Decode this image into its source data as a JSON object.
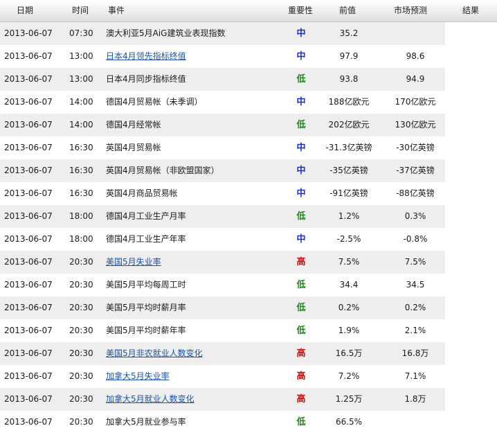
{
  "headers": {
    "date": "日期",
    "time": "时间",
    "event": "事件",
    "importance": "重要性",
    "previous": "前值",
    "forecast": "市场预测",
    "result": "结果"
  },
  "colors": {
    "high": "#cc1111",
    "medium": "#1a2cc8",
    "low": "#1a8a1a",
    "link": "#1a53a7",
    "row_alt": "#eeeeee"
  },
  "rows": [
    {
      "date": "2013-06-07",
      "time": "07:30",
      "event": "澳大利亚5月AiG建筑业表现指数",
      "link": false,
      "importance": "中",
      "level": "mid",
      "previous": "35.2",
      "forecast": "",
      "result": ""
    },
    {
      "date": "2013-06-07",
      "time": "13:00",
      "event": "日本4月领先指标终值",
      "link": true,
      "importance": "中",
      "level": "mid",
      "previous": "97.9",
      "forecast": "98.6",
      "result": ""
    },
    {
      "date": "2013-06-07",
      "time": "13:00",
      "event": "日本4月同步指标终值",
      "link": false,
      "importance": "低",
      "level": "low",
      "previous": "93.8",
      "forecast": "94.9",
      "result": ""
    },
    {
      "date": "2013-06-07",
      "time": "14:00",
      "event": "德国4月贸易帐（未季调）",
      "link": false,
      "importance": "中",
      "level": "mid",
      "previous": "188亿欧元",
      "forecast": "170亿欧元",
      "result": ""
    },
    {
      "date": "2013-06-07",
      "time": "14:00",
      "event": "德国4月经常帐",
      "link": false,
      "importance": "低",
      "level": "low",
      "previous": "202亿欧元",
      "forecast": "130亿欧元",
      "result": ""
    },
    {
      "date": "2013-06-07",
      "time": "16:30",
      "event": "英国4月贸易帐",
      "link": false,
      "importance": "中",
      "level": "mid",
      "previous": "-31.3亿英镑",
      "forecast": "-30亿英镑",
      "result": ""
    },
    {
      "date": "2013-06-07",
      "time": "16:30",
      "event": "英国4月贸易帐（非欧盟国家）",
      "link": false,
      "importance": "中",
      "level": "mid",
      "previous": "-35亿英镑",
      "forecast": "-37亿英镑",
      "result": ""
    },
    {
      "date": "2013-06-07",
      "time": "16:30",
      "event": "英国4月商品贸易帐",
      "link": false,
      "importance": "中",
      "level": "mid",
      "previous": "-91亿英镑",
      "forecast": "-88亿英镑",
      "result": ""
    },
    {
      "date": "2013-06-07",
      "time": "18:00",
      "event": "德国4月工业生产月率",
      "link": false,
      "importance": "低",
      "level": "low",
      "previous": "1.2%",
      "forecast": "0.3%",
      "result": ""
    },
    {
      "date": "2013-06-07",
      "time": "18:00",
      "event": "德国4月工业生产年率",
      "link": false,
      "importance": "中",
      "level": "mid",
      "previous": "-2.5%",
      "forecast": "-0.8%",
      "result": ""
    },
    {
      "date": "2013-06-07",
      "time": "20:30",
      "event": "美国5月失业率",
      "link": true,
      "importance": "高",
      "level": "high",
      "previous": "7.5%",
      "forecast": "7.5%",
      "result": ""
    },
    {
      "date": "2013-06-07",
      "time": "20:30",
      "event": "美国5月平均每周工时",
      "link": false,
      "importance": "低",
      "level": "low",
      "previous": "34.4",
      "forecast": "34.5",
      "result": ""
    },
    {
      "date": "2013-06-07",
      "time": "20:30",
      "event": "美国5月平均时薪月率",
      "link": false,
      "importance": "低",
      "level": "low",
      "previous": "0.2%",
      "forecast": "0.2%",
      "result": ""
    },
    {
      "date": "2013-06-07",
      "time": "20:30",
      "event": "美国5月平均时薪年率",
      "link": false,
      "importance": "低",
      "level": "low",
      "previous": "1.9%",
      "forecast": "2.1%",
      "result": ""
    },
    {
      "date": "2013-06-07",
      "time": "20:30",
      "event": "美国5月非农就业人数变化",
      "link": true,
      "importance": "高",
      "level": "high",
      "previous": "16.5万",
      "forecast": "16.8万",
      "result": ""
    },
    {
      "date": "2013-06-07",
      "time": "20:30",
      "event": "加拿大5月失业率",
      "link": true,
      "importance": "高",
      "level": "high",
      "previous": "7.2%",
      "forecast": "7.1%",
      "result": ""
    },
    {
      "date": "2013-06-07",
      "time": "20:30",
      "event": "加拿大5月就业人数变化",
      "link": true,
      "importance": "高",
      "level": "high",
      "previous": "1.25万",
      "forecast": "1.8万",
      "result": ""
    },
    {
      "date": "2013-06-07",
      "time": "20:30",
      "event": "加拿大5月就业参与率",
      "link": false,
      "importance": "低",
      "level": "low",
      "previous": "66.5%",
      "forecast": "",
      "result": ""
    }
  ]
}
